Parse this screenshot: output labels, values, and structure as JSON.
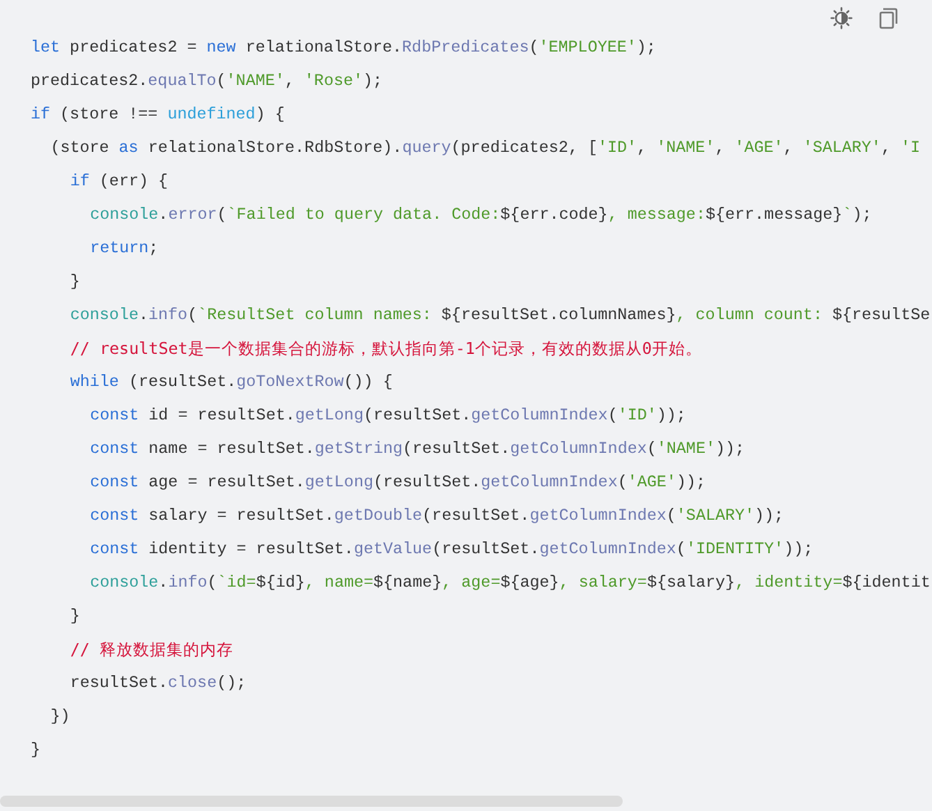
{
  "code_lines": [
    {
      "tokens": [
        {
          "text": "let",
          "kind": "kw"
        },
        {
          "text": " predicates2 = ",
          "kind": "plain"
        },
        {
          "text": "new",
          "kind": "kw"
        },
        {
          "text": " relationalStore.",
          "kind": "plain"
        },
        {
          "text": "RdbPredicates",
          "kind": "fn"
        },
        {
          "text": "(",
          "kind": "plain"
        },
        {
          "text": "'EMPLOYEE'",
          "kind": "str"
        },
        {
          "text": ");",
          "kind": "plain"
        }
      ]
    },
    {
      "tokens": [
        {
          "text": "predicates2.",
          "kind": "plain"
        },
        {
          "text": "equalTo",
          "kind": "fn"
        },
        {
          "text": "(",
          "kind": "plain"
        },
        {
          "text": "'NAME'",
          "kind": "str"
        },
        {
          "text": ", ",
          "kind": "plain"
        },
        {
          "text": "'Rose'",
          "kind": "str"
        },
        {
          "text": ");",
          "kind": "plain"
        }
      ]
    },
    {
      "tokens": [
        {
          "text": "if",
          "kind": "kw"
        },
        {
          "text": " (store !== ",
          "kind": "plain"
        },
        {
          "text": "undefined",
          "kind": "lit"
        },
        {
          "text": ") {",
          "kind": "plain"
        }
      ],
      "children": [
        {
          "tokens": [
            {
              "text": "(store ",
              "kind": "plain"
            },
            {
              "text": "as",
              "kind": "kw"
            },
            {
              "text": " relationalStore.RdbStore).",
              "kind": "plain"
            },
            {
              "text": "query",
              "kind": "fn"
            },
            {
              "text": "(predicates2, [",
              "kind": "plain"
            },
            {
              "text": "'ID'",
              "kind": "str"
            },
            {
              "text": ", ",
              "kind": "plain"
            },
            {
              "text": "'NAME'",
              "kind": "str"
            },
            {
              "text": ", ",
              "kind": "plain"
            },
            {
              "text": "'AGE'",
              "kind": "str"
            },
            {
              "text": ", ",
              "kind": "plain"
            },
            {
              "text": "'SALARY'",
              "kind": "str"
            },
            {
              "text": ", ",
              "kind": "plain"
            },
            {
              "text": "'I",
              "kind": "str"
            }
          ],
          "children": [
            {
              "tokens": [
                {
                  "text": "if",
                  "kind": "kw"
                },
                {
                  "text": " (err) {",
                  "kind": "plain"
                }
              ],
              "children": [
                {
                  "tokens": [
                    {
                      "text": "console",
                      "kind": "con"
                    },
                    {
                      "text": ".",
                      "kind": "plain"
                    },
                    {
                      "text": "error",
                      "kind": "fn"
                    },
                    {
                      "text": "(",
                      "kind": "plain"
                    },
                    {
                      "text": "`Failed to query data. Code:",
                      "kind": "str"
                    },
                    {
                      "text": "${err.code}",
                      "kind": "plain"
                    },
                    {
                      "text": ", message:",
                      "kind": "str"
                    },
                    {
                      "text": "${err.message}",
                      "kind": "plain"
                    },
                    {
                      "text": "`",
                      "kind": "str"
                    },
                    {
                      "text": ");",
                      "kind": "plain"
                    }
                  ]
                },
                {
                  "tokens": [
                    {
                      "text": "return",
                      "kind": "kw"
                    },
                    {
                      "text": ";",
                      "kind": "plain"
                    }
                  ]
                }
              ]
            },
            {
              "tokens": [
                {
                  "text": "}",
                  "kind": "plain"
                }
              ]
            },
            {
              "tokens": [
                {
                  "text": "console",
                  "kind": "con"
                },
                {
                  "text": ".",
                  "kind": "plain"
                },
                {
                  "text": "info",
                  "kind": "fn"
                },
                {
                  "text": "(",
                  "kind": "plain"
                },
                {
                  "text": "`ResultSet column names: ",
                  "kind": "str"
                },
                {
                  "text": "${resultSet.columnNames}",
                  "kind": "plain"
                },
                {
                  "text": ", column count: ",
                  "kind": "str"
                },
                {
                  "text": "${resultSe",
                  "kind": "plain"
                }
              ]
            },
            {
              "tokens": [
                {
                  "text": "// resultSet是一个数据集合的游标，默认指向第-1个记录，有效的数据从0开始。",
                  "kind": "cmt"
                }
              ]
            },
            {
              "tokens": [
                {
                  "text": "while",
                  "kind": "kw"
                },
                {
                  "text": " (resultSet.",
                  "kind": "plain"
                },
                {
                  "text": "goToNextRow",
                  "kind": "fn"
                },
                {
                  "text": "()) {",
                  "kind": "plain"
                }
              ],
              "children": [
                {
                  "tokens": [
                    {
                      "text": "const",
                      "kind": "kw"
                    },
                    {
                      "text": " id = resultSet.",
                      "kind": "plain"
                    },
                    {
                      "text": "getLong",
                      "kind": "fn"
                    },
                    {
                      "text": "(resultSet.",
                      "kind": "plain"
                    },
                    {
                      "text": "getColumnIndex",
                      "kind": "fn"
                    },
                    {
                      "text": "(",
                      "kind": "plain"
                    },
                    {
                      "text": "'ID'",
                      "kind": "str"
                    },
                    {
                      "text": "));",
                      "kind": "plain"
                    }
                  ]
                },
                {
                  "tokens": [
                    {
                      "text": "const",
                      "kind": "kw"
                    },
                    {
                      "text": " name = resultSet.",
                      "kind": "plain"
                    },
                    {
                      "text": "getString",
                      "kind": "fn"
                    },
                    {
                      "text": "(resultSet.",
                      "kind": "plain"
                    },
                    {
                      "text": "getColumnIndex",
                      "kind": "fn"
                    },
                    {
                      "text": "(",
                      "kind": "plain"
                    },
                    {
                      "text": "'NAME'",
                      "kind": "str"
                    },
                    {
                      "text": "));",
                      "kind": "plain"
                    }
                  ]
                },
                {
                  "tokens": [
                    {
                      "text": "const",
                      "kind": "kw"
                    },
                    {
                      "text": " age = resultSet.",
                      "kind": "plain"
                    },
                    {
                      "text": "getLong",
                      "kind": "fn"
                    },
                    {
                      "text": "(resultSet.",
                      "kind": "plain"
                    },
                    {
                      "text": "getColumnIndex",
                      "kind": "fn"
                    },
                    {
                      "text": "(",
                      "kind": "plain"
                    },
                    {
                      "text": "'AGE'",
                      "kind": "str"
                    },
                    {
                      "text": "));",
                      "kind": "plain"
                    }
                  ]
                },
                {
                  "tokens": [
                    {
                      "text": "const",
                      "kind": "kw"
                    },
                    {
                      "text": " salary = resultSet.",
                      "kind": "plain"
                    },
                    {
                      "text": "getDouble",
                      "kind": "fn"
                    },
                    {
                      "text": "(resultSet.",
                      "kind": "plain"
                    },
                    {
                      "text": "getColumnIndex",
                      "kind": "fn"
                    },
                    {
                      "text": "(",
                      "kind": "plain"
                    },
                    {
                      "text": "'SALARY'",
                      "kind": "str"
                    },
                    {
                      "text": "));",
                      "kind": "plain"
                    }
                  ]
                },
                {
                  "tokens": [
                    {
                      "text": "const",
                      "kind": "kw"
                    },
                    {
                      "text": " identity = resultSet.",
                      "kind": "plain"
                    },
                    {
                      "text": "getValue",
                      "kind": "fn"
                    },
                    {
                      "text": "(resultSet.",
                      "kind": "plain"
                    },
                    {
                      "text": "getColumnIndex",
                      "kind": "fn"
                    },
                    {
                      "text": "(",
                      "kind": "plain"
                    },
                    {
                      "text": "'IDENTITY'",
                      "kind": "str"
                    },
                    {
                      "text": "));",
                      "kind": "plain"
                    }
                  ]
                },
                {
                  "tokens": [
                    {
                      "text": "console",
                      "kind": "con"
                    },
                    {
                      "text": ".",
                      "kind": "plain"
                    },
                    {
                      "text": "info",
                      "kind": "fn"
                    },
                    {
                      "text": "(",
                      "kind": "plain"
                    },
                    {
                      "text": "`id=",
                      "kind": "str"
                    },
                    {
                      "text": "${id}",
                      "kind": "plain"
                    },
                    {
                      "text": ", name=",
                      "kind": "str"
                    },
                    {
                      "text": "${name}",
                      "kind": "plain"
                    },
                    {
                      "text": ", age=",
                      "kind": "str"
                    },
                    {
                      "text": "${age}",
                      "kind": "plain"
                    },
                    {
                      "text": ", salary=",
                      "kind": "str"
                    },
                    {
                      "text": "${salary}",
                      "kind": "plain"
                    },
                    {
                      "text": ", identity=",
                      "kind": "str"
                    },
                    {
                      "text": "${identit",
                      "kind": "plain"
                    }
                  ]
                }
              ]
            },
            {
              "tokens": [
                {
                  "text": "}",
                  "kind": "plain"
                }
              ]
            },
            {
              "tokens": [
                {
                  "text": "// 释放数据集的内存",
                  "kind": "cmt"
                }
              ]
            },
            {
              "tokens": [
                {
                  "text": "resultSet.",
                  "kind": "plain"
                },
                {
                  "text": "close",
                  "kind": "fn"
                },
                {
                  "text": "();",
                  "kind": "plain"
                }
              ]
            }
          ]
        },
        {
          "tokens": [
            {
              "text": "})",
              "kind": "plain"
            }
          ]
        }
      ]
    },
    {
      "tokens": [
        {
          "text": "}",
          "kind": "plain"
        }
      ]
    }
  ]
}
